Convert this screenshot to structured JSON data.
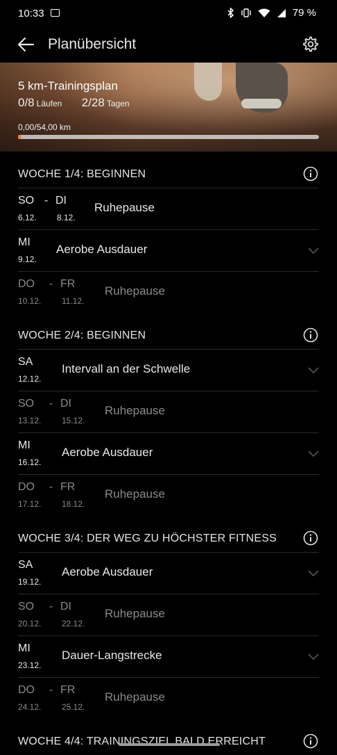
{
  "status_bar": {
    "time": "10:33",
    "battery": "79 %"
  },
  "app_bar": {
    "title": "Planübersicht"
  },
  "hero": {
    "plan_title": "5 km-Trainingsplan",
    "runs_value": "0/8",
    "runs_label": "Läufen",
    "days_value": "2/28",
    "days_label": "Tagen",
    "distance": "0,00/54,00 km",
    "progress_fraction": 0.01
  },
  "weeks": [
    {
      "title": "WOCHE 1/4:  BEGINNEN",
      "rows": [
        {
          "day": "SO",
          "date": "6.12.",
          "day2": "DI",
          "date2": "8.12.",
          "activity": "Ruhepause",
          "dim": false,
          "expandable": false
        },
        {
          "day": "MI",
          "date": "9.12.",
          "activity": "Aerobe Ausdauer",
          "dim": false,
          "expandable": true
        },
        {
          "day": "DO",
          "date": "10.12.",
          "day2": "FR",
          "date2": "11.12.",
          "activity": "Ruhepause",
          "dim": true,
          "expandable": false
        }
      ]
    },
    {
      "title": "WOCHE 2/4:  BEGINNEN",
      "rows": [
        {
          "day": "SA",
          "date": "12.12.",
          "activity": "Intervall an der Schwelle",
          "dim": false,
          "expandable": true
        },
        {
          "day": "SO",
          "date": "13.12.",
          "day2": "DI",
          "date2": "15.12.",
          "activity": "Ruhepause",
          "dim": true,
          "expandable": false
        },
        {
          "day": "MI",
          "date": "16.12.",
          "activity": "Aerobe Ausdauer",
          "dim": false,
          "expandable": true
        },
        {
          "day": "DO",
          "date": "17.12.",
          "day2": "FR",
          "date2": "18.12.",
          "activity": "Ruhepause",
          "dim": true,
          "expandable": false
        }
      ]
    },
    {
      "title": "WOCHE 3/4:  DER WEG ZU HÖCHSTER FITNESS",
      "rows": [
        {
          "day": "SA",
          "date": "19.12.",
          "activity": "Aerobe Ausdauer",
          "dim": false,
          "expandable": true
        },
        {
          "day": "SO",
          "date": "20.12.",
          "day2": "DI",
          "date2": "22.12.",
          "activity": "Ruhepause",
          "dim": true,
          "expandable": false
        },
        {
          "day": "MI",
          "date": "23.12.",
          "activity": "Dauer-Langstrecke",
          "dim": false,
          "expandable": true
        },
        {
          "day": "DO",
          "date": "24.12.",
          "day2": "FR",
          "date2": "25.12.",
          "activity": "Ruhepause",
          "dim": true,
          "expandable": false
        }
      ]
    },
    {
      "title": "WOCHE 4/4:  TRAININGSZIEL BALD ERREICHT",
      "rows": []
    }
  ],
  "icons": {
    "back": "arrow-left-icon",
    "settings": "gear-icon",
    "info": "info-icon",
    "expand": "chevron-down-icon"
  }
}
